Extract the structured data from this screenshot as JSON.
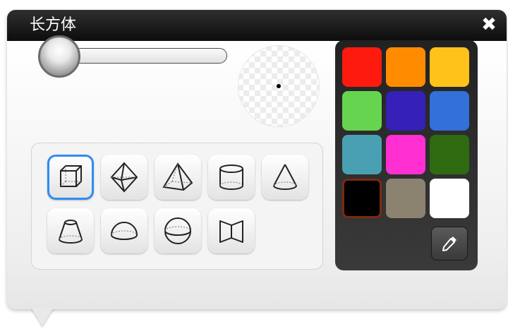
{
  "window": {
    "title": "长方体"
  },
  "close_icon": "close-x",
  "slider": {
    "value": 0
  },
  "shapes": [
    {
      "name": "cube"
    },
    {
      "name": "octahedron"
    },
    {
      "name": "pyramid"
    },
    {
      "name": "cylinder"
    },
    {
      "name": "cone"
    },
    {
      "name": "frustum"
    },
    {
      "name": "hemisphere"
    },
    {
      "name": "sphere"
    },
    {
      "name": "open-book"
    }
  ],
  "selected_shape": "cube",
  "palette": {
    "colors": [
      "#ff1a0f",
      "#ff8c00",
      "#ffc21a",
      "#66d44f",
      "#3520b8",
      "#3370d8",
      "#4aa0b3",
      "#ff2fd2",
      "#2f6a10",
      "#000000",
      "#8c8270",
      "#ffffff"
    ],
    "selected": "#000000",
    "eyedropper_icon": "eyedropper"
  }
}
